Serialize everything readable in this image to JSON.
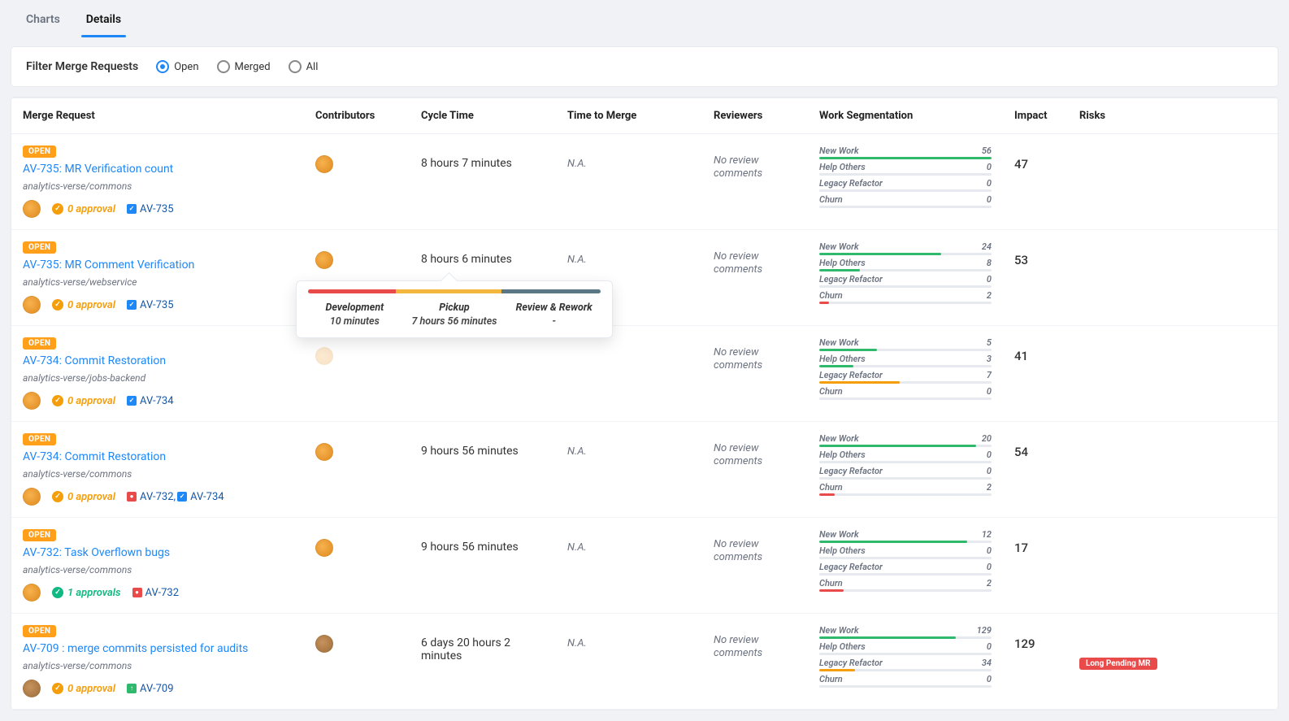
{
  "tabs": {
    "charts": "Charts",
    "details": "Details"
  },
  "filter": {
    "label": "Filter Merge Requests",
    "options": {
      "open": "Open",
      "merged": "Merged",
      "all": "All"
    },
    "selected": "open"
  },
  "columns": {
    "mr": "Merge Request",
    "contributors": "Contributors",
    "cycle": "Cycle Time",
    "ttm": "Time to Merge",
    "reviewers": "Reviewers",
    "seg": "Work Segmentation",
    "impact": "Impact",
    "risks": "Risks"
  },
  "seg_labels": {
    "new_work": "New Work",
    "help_others": "Help Others",
    "legacy_refactor": "Legacy Refactor",
    "churn": "Churn"
  },
  "tooltip": {
    "dev_label": "Development",
    "dev_value": "10 minutes",
    "pickup_label": "Pickup",
    "pickup_value": "7 hours 56 minutes",
    "review_label": "Review & Rework",
    "review_value": "-"
  },
  "risk_labels": {
    "long_pending": "Long Pending MR"
  },
  "badge_open": "OPEN",
  "no_review": "No review comments",
  "rows": [
    {
      "title": "AV-735: MR Verification count",
      "repo": "analytics-verse/commons",
      "approval_count": 0,
      "approval_text": "0 approval",
      "issues": [
        {
          "label": "AV-735",
          "color": "blue"
        }
      ],
      "cycle": "8 hours 7 minutes",
      "ttm": "N.A.",
      "impact": "47",
      "seg": {
        "new_work": 56,
        "help_others": 0,
        "legacy_refactor": 0,
        "churn": 0
      },
      "seg_max": 56,
      "avatar": "orange",
      "tooltip": false,
      "risk": null
    },
    {
      "title": "AV-735: MR Comment Verification",
      "repo": "analytics-verse/webservice",
      "approval_count": 0,
      "approval_text": "0 approval",
      "issues": [
        {
          "label": "AV-735",
          "color": "blue"
        }
      ],
      "cycle": "8 hours 6 minutes",
      "ttm": "N.A.",
      "impact": "53",
      "seg": {
        "new_work": 24,
        "help_others": 8,
        "legacy_refactor": 0,
        "churn": 2
      },
      "seg_max": 34,
      "avatar": "orange",
      "tooltip": true,
      "risk": null
    },
    {
      "title": "AV-734: Commit Restoration",
      "repo": "analytics-verse/jobs-backend",
      "approval_count": 0,
      "approval_text": "0 approval",
      "issues": [
        {
          "label": "AV-734",
          "color": "blue"
        }
      ],
      "cycle": "",
      "ttm": "",
      "impact": "41",
      "seg": {
        "new_work": 5,
        "help_others": 3,
        "legacy_refactor": 7,
        "churn": 0
      },
      "seg_max": 15,
      "avatar": "orange",
      "avatar_covered": true,
      "tooltip": false,
      "risk": null
    },
    {
      "title": "AV-734: Commit Restoration",
      "repo": "analytics-verse/commons",
      "approval_count": 0,
      "approval_text": "0 approval",
      "issues": [
        {
          "label": "AV-732",
          "color": "red",
          "trailing_comma": true
        },
        {
          "label": "AV-734",
          "color": "blue"
        }
      ],
      "cycle": "9 hours 56 minutes",
      "ttm": "N.A.",
      "impact": "54",
      "seg": {
        "new_work": 20,
        "help_others": 0,
        "legacy_refactor": 0,
        "churn": 2
      },
      "seg_max": 22,
      "avatar": "orange",
      "tooltip": false,
      "risk": null
    },
    {
      "title": "AV-732: Task Overflown bugs",
      "repo": "analytics-verse/commons",
      "approval_count": 1,
      "approval_text": "1 approvals",
      "issues": [
        {
          "label": "AV-732",
          "color": "red"
        }
      ],
      "cycle": "9 hours 56 minutes",
      "ttm": "N.A.",
      "impact": "17",
      "seg": {
        "new_work": 12,
        "help_others": 0,
        "legacy_refactor": 0,
        "churn": 2
      },
      "seg_max": 14,
      "avatar": "orange",
      "tooltip": false,
      "risk": null
    },
    {
      "title": "AV-709 : merge commits persisted for audits",
      "repo": "analytics-verse/commons",
      "approval_count": 0,
      "approval_text": "0 approval",
      "issues": [
        {
          "label": "AV-709",
          "color": "green"
        }
      ],
      "cycle": "6 days 20 hours 2 minutes",
      "ttm": "N.A.",
      "impact": "129",
      "seg": {
        "new_work": 129,
        "help_others": 0,
        "legacy_refactor": 34,
        "churn": 0
      },
      "seg_max": 163,
      "avatar": "brown",
      "tooltip": false,
      "risk": "long_pending"
    }
  ]
}
